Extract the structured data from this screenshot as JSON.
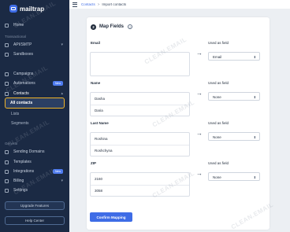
{
  "brand": {
    "name": "mailtrap"
  },
  "breadcrumb": {
    "parent": "Contacts",
    "separator": ">",
    "current": "Import contacts"
  },
  "sidebar": {
    "home": "Home",
    "section_transactional": "Transactional",
    "api_smtp": "API/SMTP",
    "sandboxes": "Sandboxes",
    "campaigns": "Campaigns",
    "automations": "Automations",
    "automations_badge": "New",
    "contacts": "Contacts",
    "all_contacts": "All contacts",
    "lists": "Lists",
    "segments": "Segments",
    "section_general": "General",
    "sending_domains": "Sending Domains",
    "templates": "Templates",
    "integrations": "Integrations",
    "integrations_badge": "New",
    "billing": "Billing",
    "settings": "Settings",
    "upgrade": "Upgrade Features",
    "help": "Help Center"
  },
  "card": {
    "step": "2",
    "title": "Map Fields",
    "help_icon": "?",
    "confirm_label": "Confirm Mapping",
    "used_as_field_label": "Used as field",
    "fields": [
      {
        "label": "Email",
        "samples": [
          "",
          ""
        ],
        "mapped": "Email"
      },
      {
        "label": "Name",
        "samples": [
          "Dasha",
          "Daria"
        ],
        "mapped": "None"
      },
      {
        "label": "Last Name",
        "samples": [
          "Roshina",
          "Roshchyna"
        ],
        "mapped": "None"
      },
      {
        "label": "ZIP",
        "samples": [
          "2160",
          "3058"
        ],
        "mapped": "None"
      }
    ]
  },
  "watermark": "CLEAN.EMAIL",
  "colors": {
    "sidebar": "#1b2a44",
    "accent": "#3e6ce6",
    "highlight": "#f0b429"
  },
  "icons": [
    "hamburger-icon",
    "arrow-right-icon",
    "chevron-down-icon",
    "help-icon"
  ]
}
